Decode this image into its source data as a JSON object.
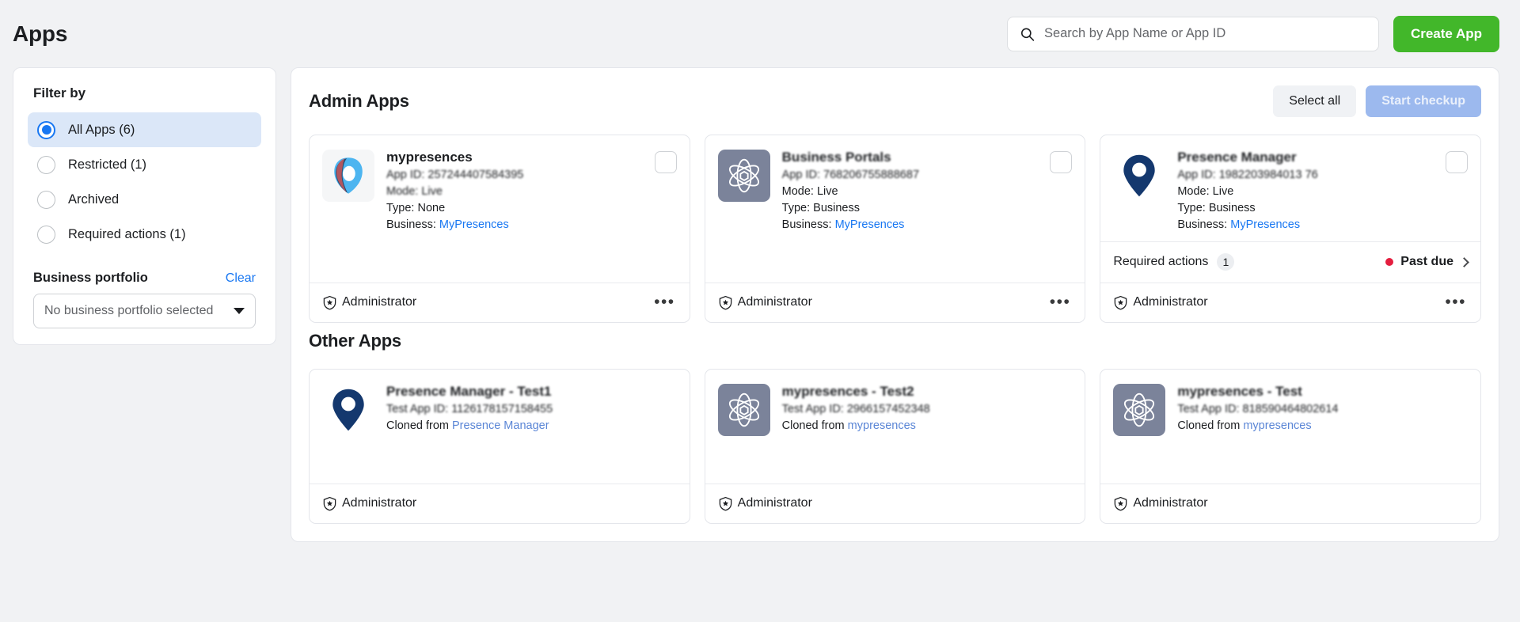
{
  "header": {
    "title": "Apps",
    "search_placeholder": "Search by App Name or App ID",
    "search_value": "",
    "search_icon": "search-icon",
    "create_app_label": "Create App",
    "create_app_color": "#42b72a"
  },
  "sidebar": {
    "filter_heading": "Filter by",
    "filters": [
      {
        "label": "All Apps (6)",
        "selected": true
      },
      {
        "label": "Restricted (1)",
        "selected": false
      },
      {
        "label": "Archived",
        "selected": false
      },
      {
        "label": "Required actions (1)",
        "selected": false
      }
    ],
    "portfolio": {
      "title": "Business portfolio",
      "clear_label": "Clear",
      "selected_value": "No business portfolio selected",
      "caret_icon": "chevron-down-icon"
    },
    "accent_color": "#1877f2",
    "selected_bg": "#dbe7f8"
  },
  "admin_section": {
    "title": "Admin Apps",
    "select_all_label": "Select all",
    "start_checkup_label": "Start checkup",
    "cards": [
      {
        "name": "mypresences",
        "app_id_line": "App ID: 257244407584395",
        "mode_line": "Mode: Live",
        "type_line": "Type: None",
        "business_prefix": "Business: ",
        "business_name": "MyPresences",
        "logo": "mypresences-pin-logo",
        "has_checkbox": true,
        "role": "Administrator",
        "role_icon": "shield-star-icon",
        "menu_icon": "ellipsis-icon",
        "required_actions": null
      },
      {
        "name": "Business Portals",
        "app_id_line": "App ID: 768206755888687",
        "mode_line": "Mode: Live",
        "type_line": "Type: Business",
        "business_prefix": "Business: ",
        "business_name": "MyPresences",
        "logo": "atom-cube-logo",
        "has_checkbox": true,
        "role": "Administrator",
        "role_icon": "shield-star-icon",
        "menu_icon": "ellipsis-icon",
        "required_actions": null
      },
      {
        "name": "Presence Manager",
        "app_id_line": "App ID: 1982203984013 76",
        "mode_line": "Mode: Live",
        "type_line": "Type: Business",
        "business_prefix": "Business: ",
        "business_name": "MyPresences",
        "logo": "map-pin-logo",
        "has_checkbox": true,
        "role": "Administrator",
        "role_icon": "shield-star-icon",
        "menu_icon": "ellipsis-icon",
        "required_actions": {
          "label": "Required actions",
          "count": "1",
          "status": "Past due",
          "status_color": "#e41e3f",
          "chevron_icon": "chevron-right-icon"
        }
      }
    ]
  },
  "other_section": {
    "title": "Other Apps",
    "cards": [
      {
        "name": "Presence Manager - Test1",
        "app_id_line": "Test App ID: 1126178157158455",
        "cloned_prefix": "Cloned from ",
        "cloned_from": "Presence Manager",
        "logo": "map-pin-logo",
        "has_checkbox": false,
        "role": "Administrator",
        "role_icon": "shield-star-icon"
      },
      {
        "name": "mypresences - Test2",
        "app_id_line": "Test App ID: 2966157452348",
        "cloned_prefix": "Cloned from ",
        "cloned_from": "mypresences",
        "logo": "atom-cube-logo",
        "has_checkbox": false,
        "role": "Administrator",
        "role_icon": "shield-star-icon"
      },
      {
        "name": "mypresences - Test",
        "app_id_line": "Test App ID: 818590464802614",
        "cloned_prefix": "Cloned from ",
        "cloned_from": "mypresences",
        "logo": "atom-cube-logo",
        "has_checkbox": false,
        "role": "Administrator",
        "role_icon": "shield-star-icon"
      }
    ]
  }
}
